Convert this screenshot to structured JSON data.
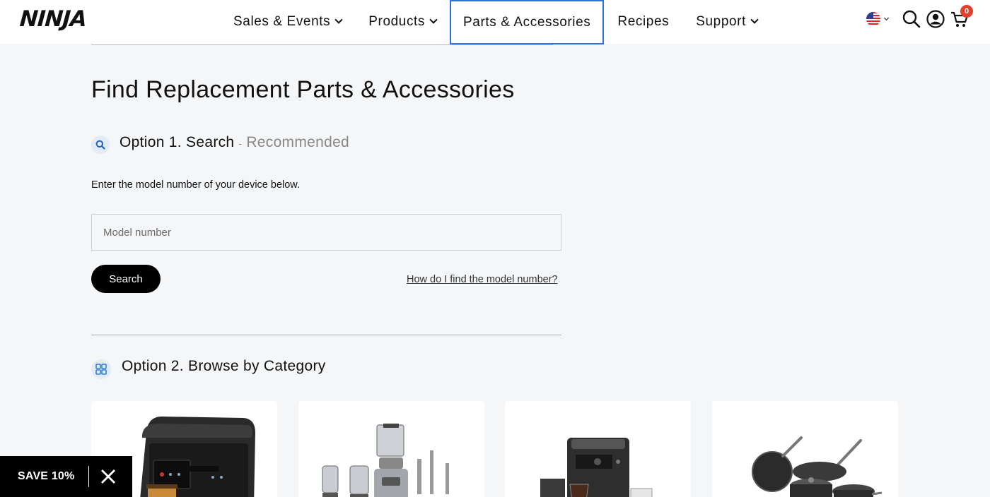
{
  "header": {
    "logo": "NINJA",
    "nav": [
      {
        "label": "Sales & Events"
      },
      {
        "label": "Products"
      },
      {
        "label": "Parts & Accessories"
      },
      {
        "label": "Recipes"
      },
      {
        "label": "Support"
      }
    ],
    "cart_count": "0"
  },
  "main": {
    "title": "Find Replacement Parts & Accessories",
    "option1": {
      "label": "Option 1. Search",
      "separator": "-",
      "sublabel": "Recommended",
      "instruction": "Enter the model number of your device below.",
      "input_placeholder": "Model number",
      "input_value": "",
      "search_button": "Search",
      "help_link": "How do I find the model number?"
    },
    "option2": {
      "label": "Option 2. Browse by Category"
    }
  },
  "promo": {
    "label": "SAVE 10%"
  },
  "colors": {
    "accent_outline": "#2f6fe0",
    "cart_badge": "#e0402a",
    "page_bg": "#f4f6f8"
  },
  "icons": [
    "us-flag-icon",
    "search-icon",
    "account-icon",
    "cart-icon",
    "search-circle-icon",
    "grid-icon",
    "close-icon"
  ]
}
